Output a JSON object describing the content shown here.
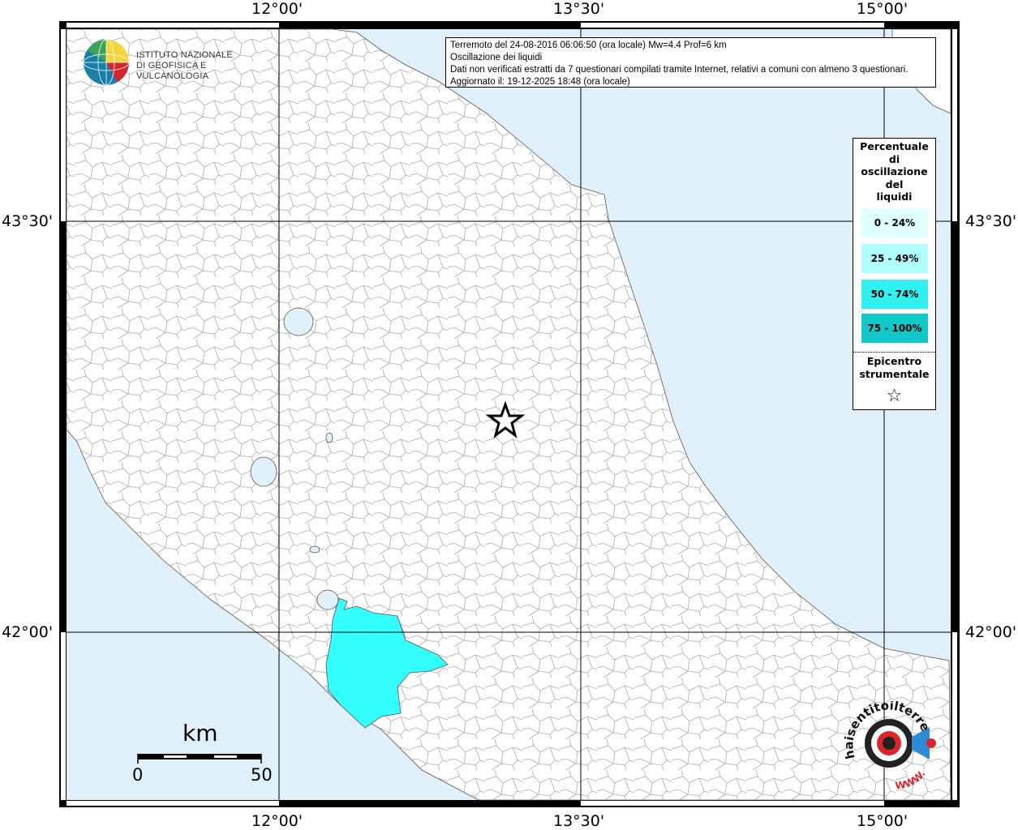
{
  "map": {
    "info": {
      "line1": "Terremoto del 24-08-2016 06:06:50 (ora locale) Mw=4.4 Prof=6 km",
      "line2": "Oscillazione dei liquidi",
      "line3": "Dati non verificati estratti da 7 questionari compilati tramite Internet, relativi a comuni con almeno 3 questionari.",
      "line4": "Aggiornato il: 19-12-2025 18:48 (ora locale)"
    },
    "logo": {
      "line1": "ISTITUTO NAZIONALE",
      "line2": "DI GEOFISICA E VULCANOLOGIA"
    },
    "axis_labels": {
      "top": [
        "12°00'",
        "13°30'",
        "15°00'"
      ],
      "bottom": [
        "12°00'",
        "13°30'",
        "15°00'"
      ],
      "left": [
        "43°30'",
        "42°00'"
      ],
      "right": [
        "43°30'",
        "42°00'"
      ]
    },
    "legend": {
      "title_lines": [
        "Percentuale",
        "di",
        "oscillazione",
        "del",
        "liquidi"
      ],
      "items": [
        {
          "label": "0 - 24%",
          "color": "#e0ffff"
        },
        {
          "label": "25 - 49%",
          "color": "#b0ffff"
        },
        {
          "label": "50 - 74%",
          "color": "#30f0f0"
        },
        {
          "label": "75 - 100%",
          "color": "#10c8c8"
        }
      ],
      "epicenter_line1": "Epicentro",
      "epicenter_line2": "strumentale",
      "epicenter_symbol": "☆"
    },
    "scale": {
      "unit": "km",
      "min": "0",
      "max": "50"
    },
    "hst_logo": {
      "text_top": "haisentitoilterremoto.it",
      "text_bottom": "WWW."
    },
    "colors": {
      "sea": "#dff0fb",
      "land": "#ffffff",
      "affected_area": "#33ffff",
      "borders": "#9a9a9a"
    }
  }
}
